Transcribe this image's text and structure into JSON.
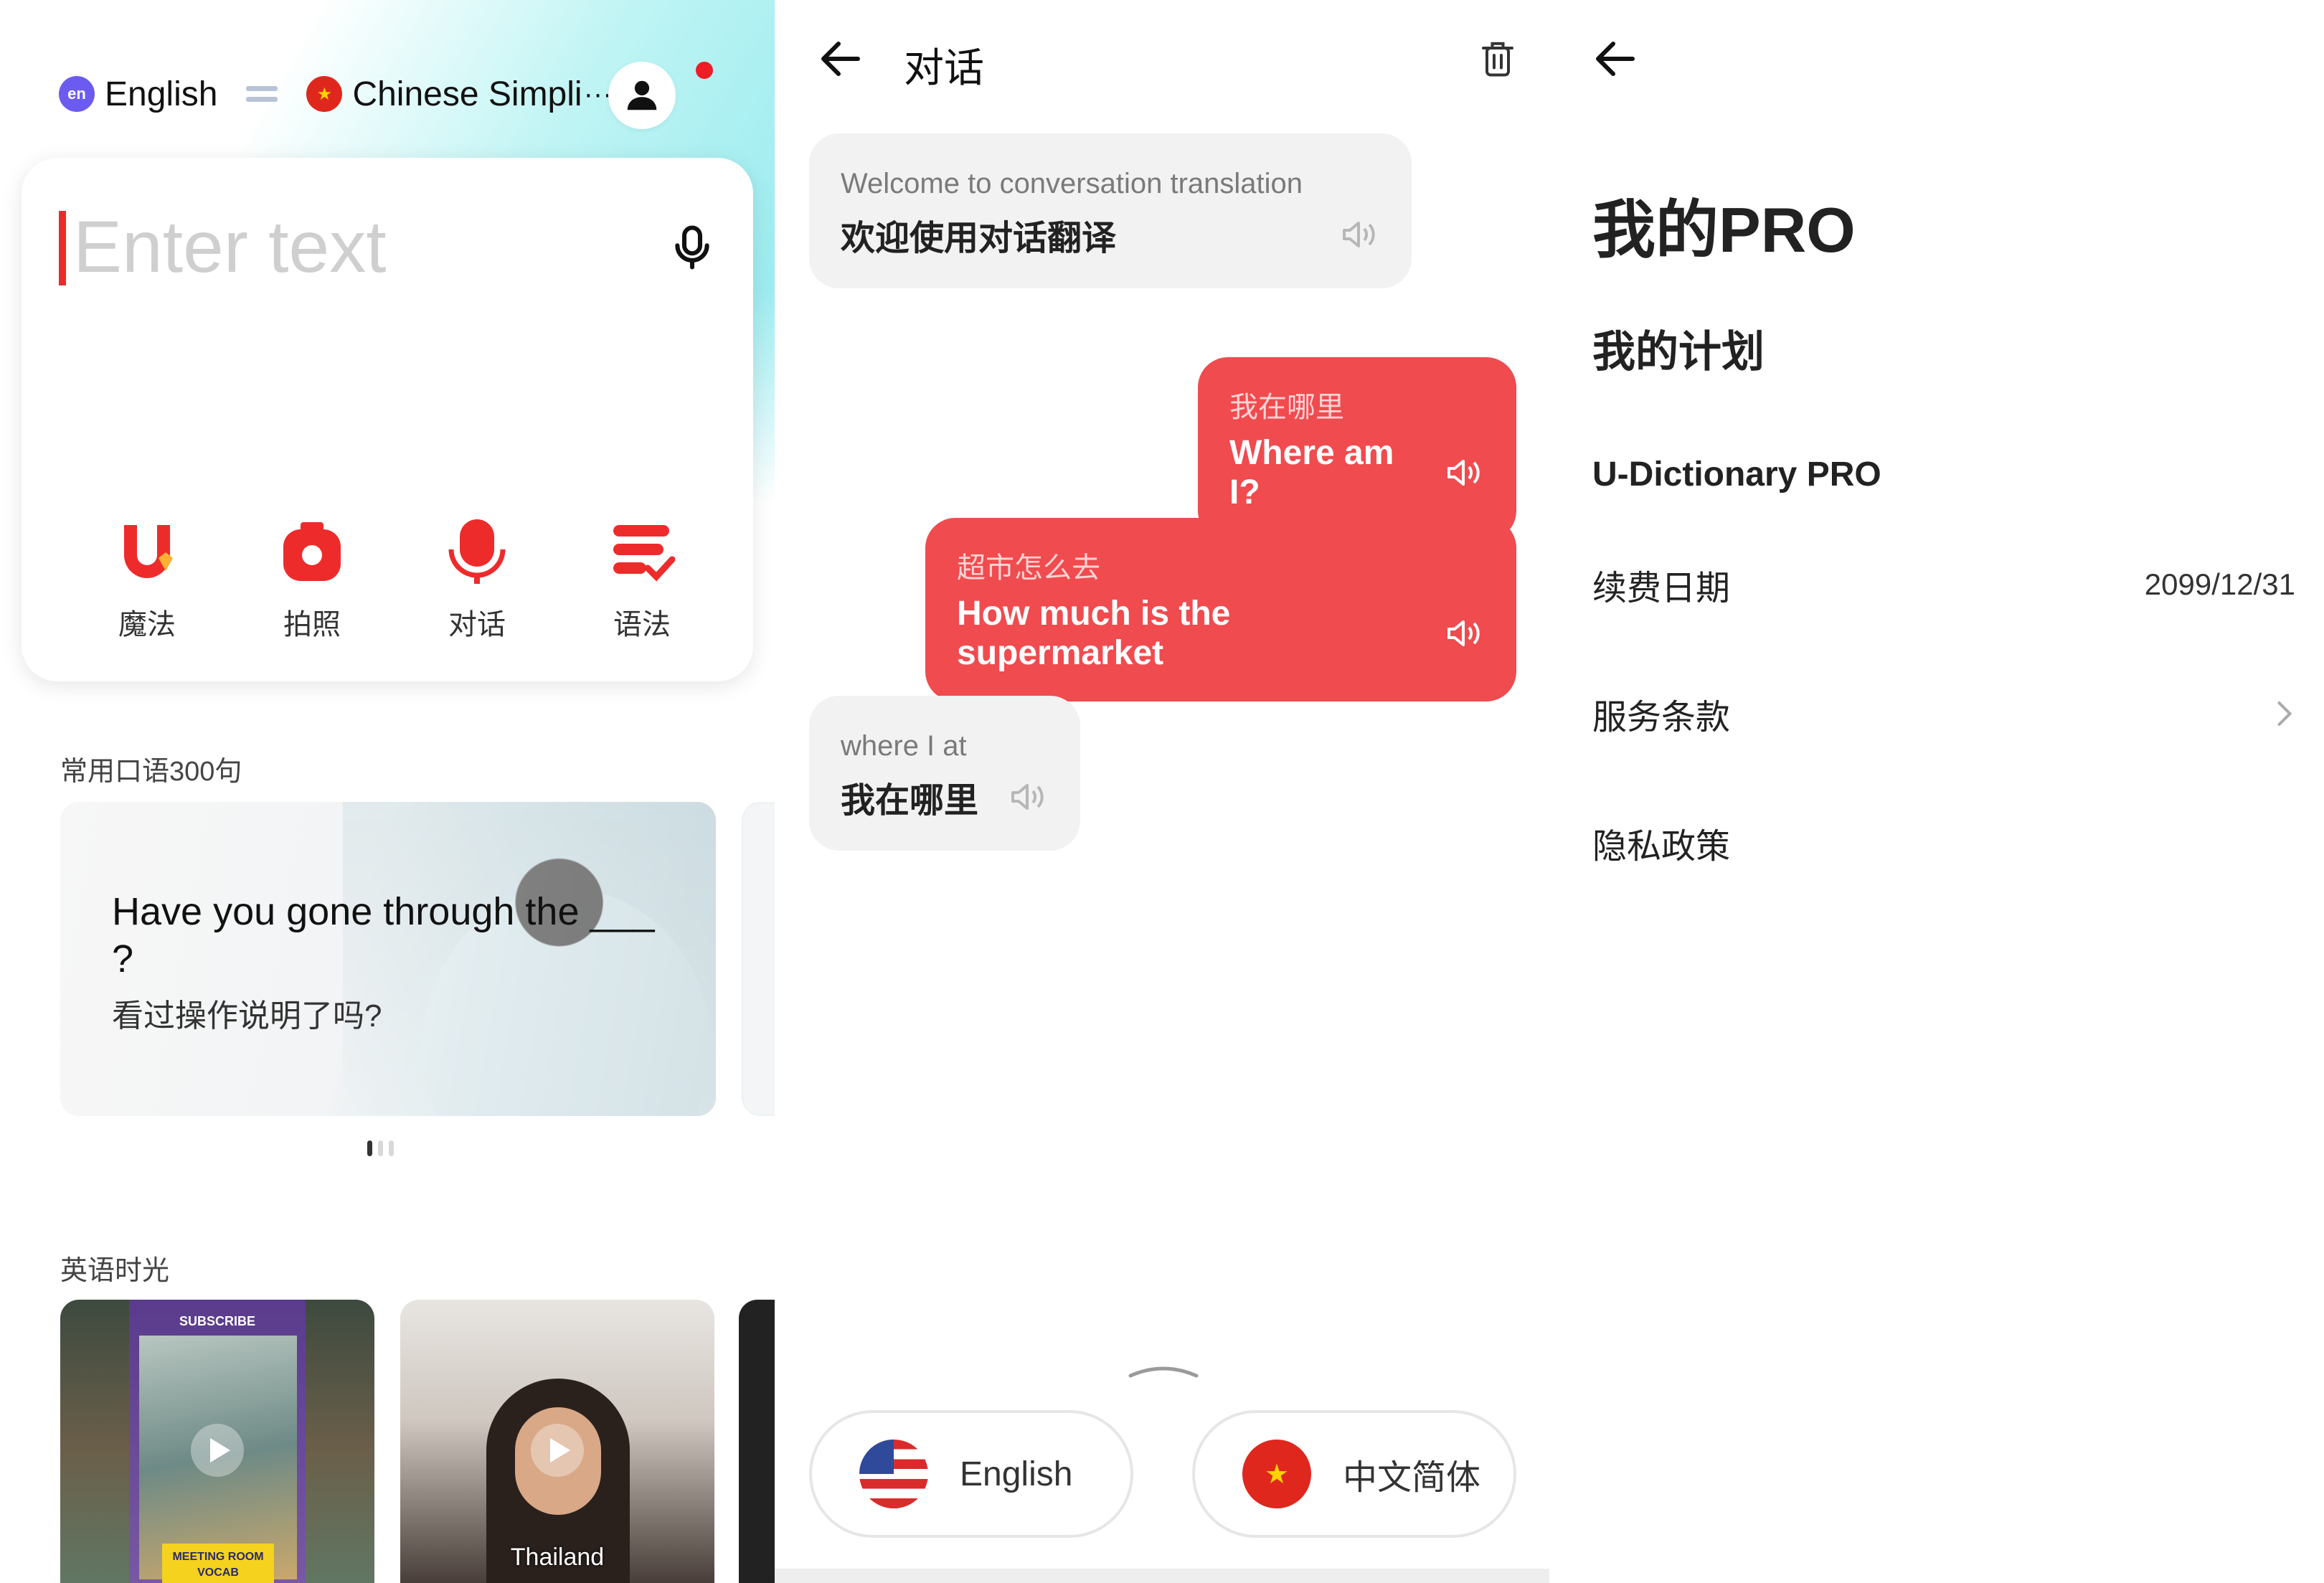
{
  "translate_home": {
    "source_lang": {
      "badge": "en",
      "name": "English"
    },
    "target_lang": {
      "flag": "★",
      "name": "Chinese Simpli",
      "more": "···"
    },
    "input": {
      "placeholder": "Enter text"
    },
    "features": [
      {
        "label": "魔法",
        "icon": "magic-u-icon"
      },
      {
        "label": "拍照",
        "icon": "camera-icon"
      },
      {
        "label": "对话",
        "icon": "microphone-icon"
      },
      {
        "label": "语法",
        "icon": "grammar-icon"
      }
    ],
    "phrases_section_title": "常用口语300句",
    "phrase_card": {
      "en": "Have you gone through the ___ ?",
      "zh": "看过操作说明了吗?"
    },
    "videos_section_title": "英语时光",
    "videos": [
      {
        "top_text": "SUBSCRIBE",
        "caption": "MEETING ROOM VOCAB"
      },
      {
        "caption": "Thailand"
      }
    ],
    "colors": {
      "accent": "#ea2b2b",
      "gradient_end": "#8ee9ee"
    }
  },
  "conversation": {
    "title": "对话",
    "messages": [
      {
        "side": "left",
        "source": "Welcome to conversation translation",
        "translation": "欢迎使用对话翻译"
      },
      {
        "side": "right",
        "source": "我在哪里",
        "translation": "Where am I?"
      },
      {
        "side": "right",
        "source": "超市怎么去",
        "translation": "How much is the supermarket"
      },
      {
        "side": "left",
        "source": "where I at",
        "translation": "我在哪里"
      }
    ],
    "lang_buttons": [
      {
        "label": "English",
        "flag": "us-flag-icon"
      },
      {
        "label": "中文简体",
        "flag": "cn-flag-icon"
      }
    ],
    "colors": {
      "bubble_red": "#f04b4f",
      "bubble_grey": "#f2f2f2"
    }
  },
  "my_pro": {
    "title": "我的PRO",
    "plan_heading": "我的计划",
    "plan_name": "U-Dictionary PRO",
    "rows": [
      {
        "label": "续费日期",
        "value": "2099/12/31"
      },
      {
        "label": "服务条款",
        "value": ""
      },
      {
        "label": "隐私政策",
        "value": ""
      }
    ]
  }
}
